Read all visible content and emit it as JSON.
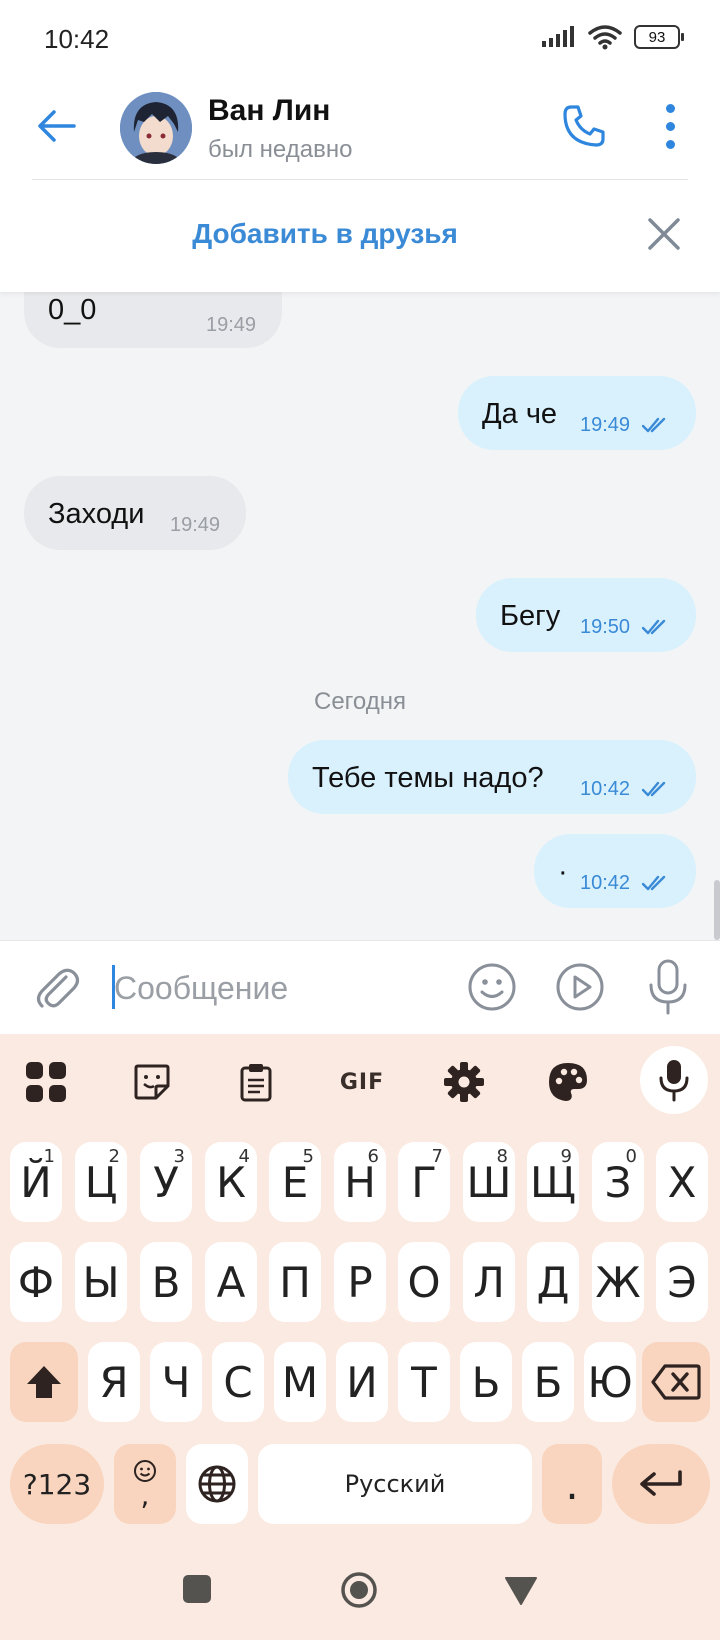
{
  "status_bar": {
    "time": "10:42",
    "battery": "93"
  },
  "header": {
    "contact_name": "Ван Лин",
    "contact_status": "был недавно"
  },
  "friend_banner": {
    "label": "Добавить в друзья"
  },
  "chat": {
    "date_separator": "Сегодня",
    "messages": [
      {
        "direction": "in",
        "text": "0_0",
        "time": "19:49"
      },
      {
        "direction": "out",
        "text": "Да че",
        "time": "19:49",
        "read": true
      },
      {
        "direction": "in",
        "text": "Заходи",
        "time": "19:49"
      },
      {
        "direction": "out",
        "text": "Бегу",
        "time": "19:50",
        "read": true
      },
      {
        "direction": "out",
        "text": "Тебе темы надо?",
        "time": "10:42",
        "read": true
      },
      {
        "direction": "out",
        "text": "·",
        "time": "10:42",
        "read": true
      }
    ]
  },
  "input": {
    "placeholder": "Сообщение"
  },
  "keyboard": {
    "toolbar": {
      "gif_label": "GIF"
    },
    "row1": [
      {
        "label": "Й",
        "hint": "1"
      },
      {
        "label": "Ц",
        "hint": "2"
      },
      {
        "label": "У",
        "hint": "3"
      },
      {
        "label": "К",
        "hint": "4"
      },
      {
        "label": "Е",
        "hint": "5"
      },
      {
        "label": "Н",
        "hint": "6"
      },
      {
        "label": "Г",
        "hint": "7"
      },
      {
        "label": "Ш",
        "hint": "8"
      },
      {
        "label": "Щ",
        "hint": "9"
      },
      {
        "label": "З",
        "hint": "0"
      },
      {
        "label": "Х",
        "hint": ""
      }
    ],
    "row2": [
      "Ф",
      "Ы",
      "В",
      "А",
      "П",
      "Р",
      "О",
      "Л",
      "Д",
      "Ж",
      "Э"
    ],
    "row3": [
      "Я",
      "Ч",
      "С",
      "М",
      "И",
      "Т",
      "Ь",
      "Б",
      "Ю"
    ],
    "symbols_key": "?123",
    "emoji_key_bottom": ",",
    "space_label": "Русский",
    "period_key": "."
  },
  "colors": {
    "accent": "#2e86de",
    "outgoing_bubble": "#d9f1fd",
    "incoming_bubble": "#e8e9ec",
    "keyboard_bg": "#fbeae1",
    "special_key": "#f9d5bf"
  }
}
